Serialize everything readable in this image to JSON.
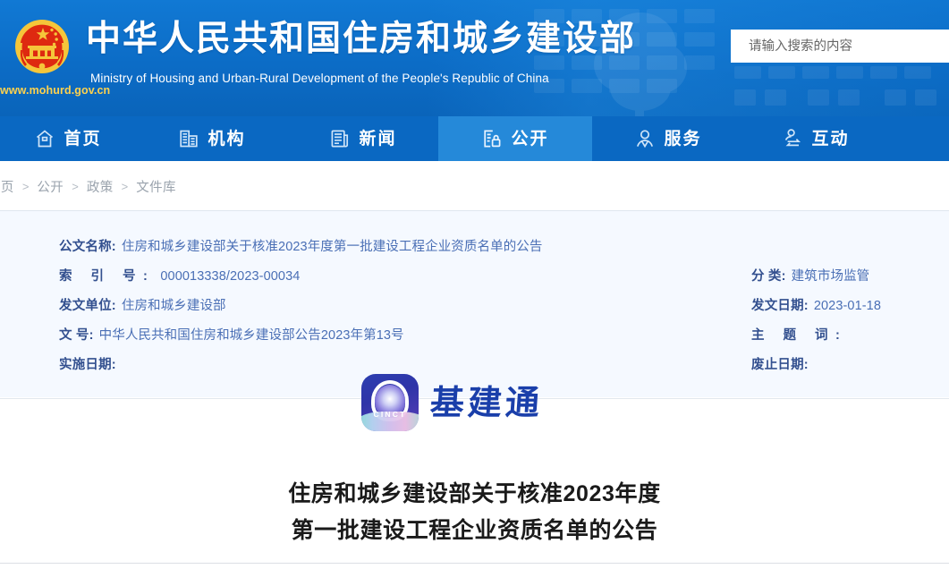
{
  "header": {
    "emblem_alt": "national-emblem",
    "site_url": "www.mohurd.gov.cn",
    "title_cn": "中华人民共和国住房和城乡建设部",
    "title_en": "Ministry of Housing and Urban-Rural Development of the People's Republic of China",
    "search": {
      "placeholder": "请输入搜索的内容",
      "value": ""
    },
    "bg_color": "#0c6cc6"
  },
  "nav": {
    "bg_color": "#0a68c2",
    "active_bg_color": "#2589d9",
    "items": [
      {
        "label": "首页",
        "icon": "home-icon",
        "active": false
      },
      {
        "label": "机构",
        "icon": "building-icon",
        "active": false
      },
      {
        "label": "新闻",
        "icon": "news-icon",
        "active": false
      },
      {
        "label": "公开",
        "icon": "disclosure-icon",
        "active": true
      },
      {
        "label": "服务",
        "icon": "service-person-icon",
        "active": false
      },
      {
        "label": "互动",
        "icon": "interaction-icon",
        "active": false
      }
    ]
  },
  "breadcrumb": {
    "items": [
      "首页",
      "公开",
      "政策",
      "文件库"
    ],
    "separator": ">"
  },
  "meta": {
    "bg_color": "#f5f9ff",
    "label_color": "#33508f",
    "value_color": "#4a6fb5",
    "left": [
      {
        "label": "公文名称:",
        "value": "住房和城乡建设部关于核准2023年度第一批建设工程企业资质名单的公告"
      },
      {
        "label": "索 引 号:",
        "value": "000013338/2023-00034"
      },
      {
        "label": "发文单位:",
        "value": "住房和城乡建设部"
      },
      {
        "label": "文    号:",
        "value": "中华人民共和国住房和城乡建设部公告2023年第13号"
      },
      {
        "label": "实施日期:",
        "value": ""
      }
    ],
    "right": [
      {
        "label": "分    类:",
        "value": "建筑市场监管"
      },
      {
        "label": "发文日期:",
        "value": "2023-01-18"
      },
      {
        "label": "主 题 词:",
        "value": ""
      },
      {
        "label": "废止日期:",
        "value": ""
      }
    ]
  },
  "watermark": {
    "badge_text": "CINCT",
    "brand": "基建通"
  },
  "document": {
    "title_line1": "住房和城乡建设部关于核准2023年度",
    "title_line2": "第一批建设工程企业资质名单的公告"
  }
}
